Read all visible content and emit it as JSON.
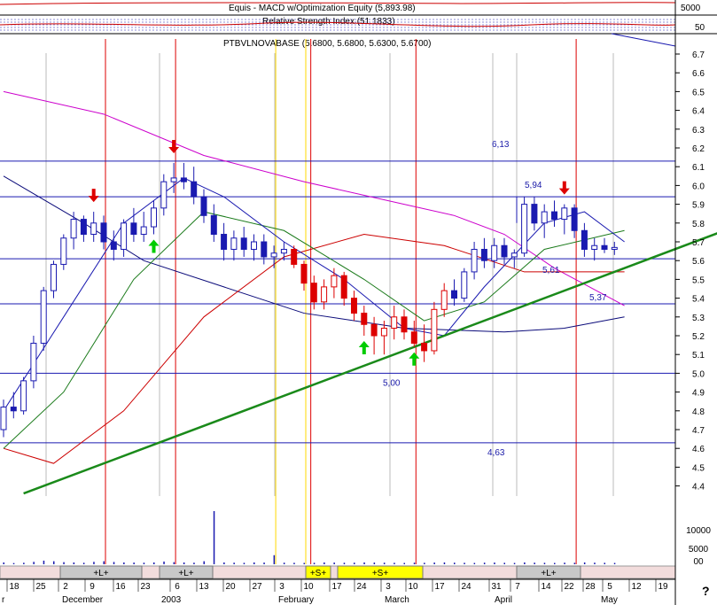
{
  "chart_data": {
    "type": "candlestick",
    "title": "PTBVLNOVABASE (5.6800, 5.6800, 5.6300, 5.6700)",
    "corner_mark": "?",
    "panels": {
      "equity_title": "Equis - MACD w/Optimization Equity (5,893.98)",
      "equity_axis_label": "5000",
      "rsi_title": "Relative Strength Index (51.1833)",
      "rsi_axis_label": "50"
    },
    "y_ticks": [
      "6.7",
      "6.6",
      "6.5",
      "6.4",
      "6.3",
      "6.2",
      "6.1",
      "6.0",
      "5.9",
      "5.8",
      "5.7",
      "5.6",
      "5.5",
      "5.4",
      "5.3",
      "5.2",
      "5.1",
      "5.0",
      "4.9",
      "4.8",
      "4.7",
      "4.6",
      "4.5",
      "4.4"
    ],
    "ylim": [
      4.3,
      6.8
    ],
    "volume_ticks": [
      "10000",
      "5000",
      "00"
    ],
    "x_day_ticks": [
      "18",
      "25",
      "2",
      "9",
      "16",
      "23",
      "6",
      "13",
      "20",
      "27",
      "3",
      "10",
      "17",
      "24",
      "3",
      "10",
      "17",
      "24",
      "31",
      "7",
      "14",
      "22",
      "28",
      "5",
      "12",
      "19"
    ],
    "months": [
      "r",
      "December",
      "2003",
      "February",
      "March",
      "April",
      "May"
    ],
    "levels": [
      {
        "value": 6.13,
        "label": "6,13"
      },
      {
        "value": 5.94,
        "label": "5,94"
      },
      {
        "value": 5.61,
        "label": "5,61"
      },
      {
        "value": 5.37,
        "label": "5,37"
      },
      {
        "value": 5.0,
        "label": "5,00"
      },
      {
        "value": 4.63,
        "label": "4,63"
      }
    ],
    "signals": [
      "+L+",
      "+L+",
      "+S+",
      "+S+",
      "+L+"
    ],
    "candles": [
      [
        4.7,
        4.86,
        4.66,
        4.82
      ],
      [
        4.82,
        4.9,
        4.76,
        4.8
      ],
      [
        4.8,
        4.98,
        4.78,
        4.96
      ],
      [
        4.96,
        5.2,
        4.92,
        5.16
      ],
      [
        5.16,
        5.46,
        5.12,
        5.44
      ],
      [
        5.44,
        5.6,
        5.4,
        5.58
      ],
      [
        5.58,
        5.74,
        5.55,
        5.72
      ],
      [
        5.72,
        5.86,
        5.66,
        5.82
      ],
      [
        5.82,
        5.84,
        5.7,
        5.74
      ],
      [
        5.74,
        5.86,
        5.7,
        5.8
      ],
      [
        5.8,
        5.84,
        5.66,
        5.7
      ],
      [
        5.7,
        5.76,
        5.6,
        5.66
      ],
      [
        5.66,
        5.82,
        5.62,
        5.8
      ],
      [
        5.8,
        5.88,
        5.7,
        5.74
      ],
      [
        5.74,
        5.86,
        5.7,
        5.78
      ],
      [
        5.78,
        5.92,
        5.74,
        5.88
      ],
      [
        5.88,
        6.06,
        5.84,
        6.02
      ],
      [
        6.02,
        6.12,
        5.96,
        6.04
      ],
      [
        6.04,
        6.12,
        5.98,
        6.02
      ],
      [
        6.02,
        6.1,
        5.9,
        5.94
      ],
      [
        5.94,
        5.98,
        5.8,
        5.84
      ],
      [
        5.84,
        5.9,
        5.7,
        5.74
      ],
      [
        5.74,
        5.8,
        5.6,
        5.66
      ],
      [
        5.66,
        5.76,
        5.6,
        5.72
      ],
      [
        5.72,
        5.78,
        5.62,
        5.66
      ],
      [
        5.66,
        5.74,
        5.6,
        5.7
      ],
      [
        5.7,
        5.74,
        5.58,
        5.62
      ],
      [
        5.62,
        5.68,
        5.56,
        5.64
      ],
      [
        5.64,
        5.7,
        5.6,
        5.66
      ],
      [
        5.66,
        5.68,
        5.56,
        5.58
      ],
      [
        5.58,
        5.6,
        5.44,
        5.48
      ],
      [
        5.48,
        5.52,
        5.34,
        5.38
      ],
      [
        5.38,
        5.5,
        5.34,
        5.46
      ],
      [
        5.46,
        5.56,
        5.4,
        5.52
      ],
      [
        5.52,
        5.54,
        5.36,
        5.4
      ],
      [
        5.4,
        5.44,
        5.28,
        5.32
      ],
      [
        5.32,
        5.36,
        5.2,
        5.26
      ],
      [
        5.26,
        5.3,
        5.1,
        5.2
      ],
      [
        5.2,
        5.28,
        5.1,
        5.24
      ],
      [
        5.24,
        5.36,
        5.18,
        5.3
      ],
      [
        5.3,
        5.34,
        5.18,
        5.22
      ],
      [
        5.22,
        5.28,
        5.14,
        5.16
      ],
      [
        5.16,
        5.26,
        5.06,
        5.12
      ],
      [
        5.12,
        5.38,
        5.1,
        5.34
      ],
      [
        5.34,
        5.48,
        5.3,
        5.44
      ],
      [
        5.44,
        5.5,
        5.36,
        5.4
      ],
      [
        5.4,
        5.56,
        5.38,
        5.54
      ],
      [
        5.54,
        5.7,
        5.5,
        5.66
      ],
      [
        5.66,
        5.72,
        5.56,
        5.6
      ],
      [
        5.6,
        5.72,
        5.56,
        5.68
      ],
      [
        5.68,
        5.72,
        5.58,
        5.62
      ],
      [
        5.62,
        5.66,
        5.56,
        5.64
      ],
      [
        5.64,
        5.94,
        5.62,
        5.9
      ],
      [
        5.9,
        5.94,
        5.76,
        5.8
      ],
      [
        5.8,
        5.9,
        5.72,
        5.86
      ],
      [
        5.86,
        5.92,
        5.78,
        5.82
      ],
      [
        5.82,
        5.9,
        5.74,
        5.88
      ],
      [
        5.88,
        5.9,
        5.72,
        5.76
      ],
      [
        5.76,
        5.8,
        5.62,
        5.66
      ],
      [
        5.66,
        5.72,
        5.6,
        5.68
      ],
      [
        5.68,
        5.72,
        5.64,
        5.66
      ],
      [
        5.66,
        5.7,
        5.63,
        5.67
      ]
    ],
    "volume": [
      300,
      200,
      250,
      400,
      600,
      500,
      350,
      300,
      250,
      400,
      500,
      380,
      300,
      280,
      260,
      300,
      450,
      350,
      300,
      260,
      500,
      8800,
      300,
      260,
      240,
      300,
      280,
      1500,
      260,
      240,
      220,
      240,
      300,
      280,
      250,
      260,
      300,
      280,
      260,
      240,
      220,
      260,
      240,
      280,
      300,
      260,
      240,
      220,
      260,
      280,
      240,
      220,
      300,
      260,
      240,
      220,
      260,
      240,
      300,
      260,
      240,
      220
    ],
    "series_lines": [
      {
        "color": "#cc00cc",
        "points": [
          [
            0,
            6.5
          ],
          [
            10,
            6.38
          ],
          [
            20,
            6.16
          ],
          [
            30,
            6.02
          ],
          [
            40,
            5.9
          ],
          [
            45,
            5.84
          ],
          [
            50,
            5.74
          ],
          [
            55,
            5.56
          ],
          [
            62,
            5.36
          ]
        ]
      },
      {
        "color": "#0b0b7a",
        "points": [
          [
            0,
            6.05
          ],
          [
            8,
            5.8
          ],
          [
            14,
            5.6
          ],
          [
            22,
            5.46
          ],
          [
            30,
            5.32
          ],
          [
            40,
            5.24
          ],
          [
            50,
            5.22
          ],
          [
            56,
            5.24
          ],
          [
            62,
            5.3
          ]
        ]
      },
      {
        "color": "#cc0000",
        "points": [
          [
            0,
            4.6
          ],
          [
            5,
            4.52
          ],
          [
            12,
            4.8
          ],
          [
            20,
            5.3
          ],
          [
            28,
            5.62
          ],
          [
            36,
            5.74
          ],
          [
            44,
            5.68
          ],
          [
            52,
            5.54
          ],
          [
            62,
            5.54
          ]
        ]
      },
      {
        "color": "#1a7a1a",
        "points": [
          [
            0,
            4.6
          ],
          [
            6,
            4.9
          ],
          [
            13,
            5.5
          ],
          [
            20,
            5.86
          ],
          [
            28,
            5.76
          ],
          [
            36,
            5.5
          ],
          [
            42,
            5.28
          ],
          [
            48,
            5.38
          ],
          [
            54,
            5.66
          ],
          [
            62,
            5.76
          ]
        ]
      },
      {
        "color": "#1a1ab0",
        "points": [
          [
            0,
            4.8
          ],
          [
            6,
            5.3
          ],
          [
            12,
            5.8
          ],
          [
            18,
            6.04
          ],
          [
            22,
            5.94
          ],
          [
            28,
            5.7
          ],
          [
            34,
            5.5
          ],
          [
            40,
            5.24
          ],
          [
            44,
            5.2
          ],
          [
            48,
            5.46
          ],
          [
            54,
            5.8
          ],
          [
            58,
            5.86
          ],
          [
            62,
            5.7
          ]
        ]
      }
    ],
    "trendline": {
      "color": "#1a8a1a",
      "from": [
        2,
        4.36
      ],
      "to": [
        72,
        5.76
      ]
    },
    "arrows": [
      {
        "candle": 9,
        "dir": "down",
        "color": "#dd0000"
      },
      {
        "candle": 15,
        "dir": "up",
        "color": "#00cc00"
      },
      {
        "candle": 17,
        "dir": "down",
        "color": "#dd0000"
      },
      {
        "candle": 36,
        "dir": "up",
        "color": "#00cc00"
      },
      {
        "candle": 41,
        "dir": "up",
        "color": "#00cc00"
      },
      {
        "candle": 56,
        "dir": "down",
        "color": "#dd0000"
      }
    ],
    "event_lines": [
      {
        "candle": 10,
        "color": "#dd0000"
      },
      {
        "candle": 17,
        "color": "#dd0000"
      },
      {
        "candle": 27,
        "color": "#ffd800"
      },
      {
        "candle": 30,
        "color": "#ffd800"
      },
      {
        "candle": 30.5,
        "color": "#dd0000"
      },
      {
        "candle": 41,
        "color": "#dd0000"
      },
      {
        "candle": 57,
        "color": "#dd0000"
      }
    ]
  }
}
